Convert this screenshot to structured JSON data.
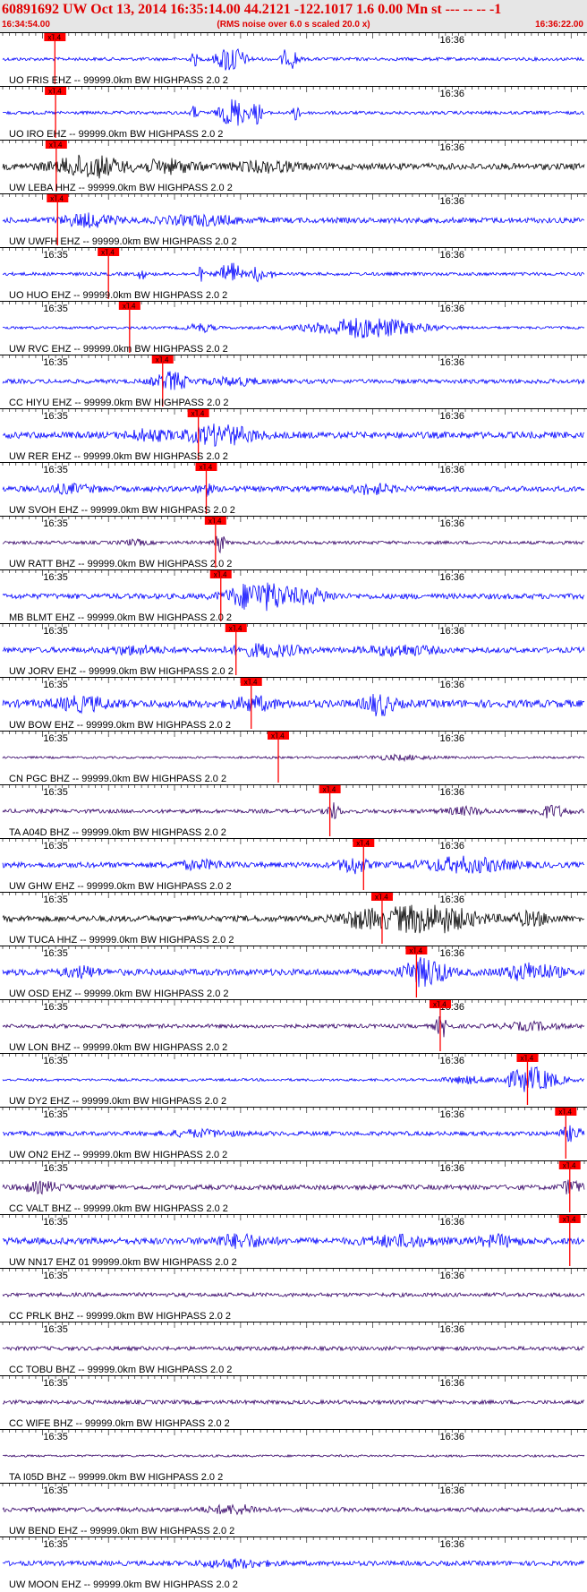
{
  "header": {
    "title": "60891692 UW Oct 13, 2014 16:35:14.00   44.2121 -122.1017  1.6 0.00 Mn st --- -- --  -1",
    "time_start": "16:34:54.00",
    "subtitle": "(RMS noise over 6.0 s scaled 20.0 x)",
    "time_end": "16:36:22.00"
  },
  "colors": {
    "header_bg": "#e6e6e6",
    "header_text": "#e00000",
    "pick": "#ff0000",
    "trace_blue": "#0000ff",
    "trace_black": "#000000",
    "trace_purple": "#330066"
  },
  "chart_data": {
    "type": "line",
    "description_free": true,
    "x_unit": "seconds after 16:34:54.00",
    "xlim": [
      0,
      88
    ],
    "tick_labels": {
      "16:35": 6,
      "16:36": 66
    },
    "pick_label": "xT.4",
    "series": [
      {
        "label": "UO FRIS EHZ -- 99999.0km BW  HIGHPASS  2.0  2",
        "pick_s": 7.9,
        "color": "#0000ff",
        "show_1635": false,
        "bursts": [
          [
            34.5,
            4,
            1.3
          ],
          [
            44,
            1.5,
            0.8
          ],
          [
            29,
            1,
            0.6
          ],
          [
            42.5,
            0.8,
            0.8
          ]
        ],
        "base": 0.15
      },
      {
        "label": "UO IRO EHZ -- 99999.0km BW  HIGHPASS  2.0  2",
        "pick_s": 8.0,
        "color": "#0000ff",
        "show_1635": false,
        "bursts": [
          [
            35,
            4,
            1.3
          ],
          [
            38.5,
            1.5,
            0.9
          ],
          [
            44.5,
            1,
            0.8
          ],
          [
            29,
            1,
            0.6
          ]
        ],
        "base": 0.15
      },
      {
        "label": "UW LEBA HHZ -- 99999.0km BW  HIGHPASS  2.0  2",
        "pick_s": 8.1,
        "color": "#000000",
        "show_1635": false,
        "bursts": [
          [
            13,
            10,
            0.9
          ],
          [
            25,
            8,
            0.5
          ],
          [
            40,
            10,
            0.35
          ]
        ],
        "base": 0.3
      },
      {
        "label": "UW UWFH EHZ -- 99999.0km BW  HIGHPASS  2.0  2",
        "pick_s": 8.3,
        "color": "#0000ff",
        "show_1635": false,
        "bursts": [
          [
            13,
            8,
            0.5
          ],
          [
            30,
            12,
            0.35
          ]
        ],
        "base": 0.25
      },
      {
        "label": "UO HUO EHZ -- 99999.0km BW  HIGHPASS  2.0  2",
        "pick_s": 16.0,
        "color": "#0000ff",
        "show_1635": true,
        "bursts": [
          [
            34.5,
            3,
            1.1
          ],
          [
            38.5,
            1.5,
            0.8
          ],
          [
            30,
            1,
            0.6
          ],
          [
            21,
            1,
            0.5
          ],
          [
            40.5,
            1,
            0.5
          ]
        ],
        "base": 0.15
      },
      {
        "label": "UW RVC EHZ -- 99999.0km BW  HIGHPASS  2.0  2",
        "pick_s": 19.2,
        "color": "#0000ff",
        "show_1635": true,
        "bursts": [
          [
            55,
            16,
            0.9
          ],
          [
            30,
            4,
            0.35
          ]
        ],
        "base": 0.12
      },
      {
        "label": "CC HIYU EHZ -- 99999.0km BW  HIGHPASS  2.0  2",
        "pick_s": 24.2,
        "color": "#0000ff",
        "show_1635": true,
        "bursts": [
          [
            25.5,
            5,
            0.8
          ],
          [
            35,
            8,
            0.3
          ]
        ],
        "base": 0.2
      },
      {
        "label": "UW RER EHZ -- 99999.0km BW  HIGHPASS  2.0  2",
        "pick_s": 29.6,
        "color": "#0000ff",
        "show_1635": true,
        "bursts": [
          [
            33,
            10,
            0.8
          ],
          [
            22,
            6,
            0.4
          ]
        ],
        "base": 0.3
      },
      {
        "label": "UW SVOH EHZ -- 99999.0km BW  HIGHPASS  2.0  2",
        "pick_s": 30.8,
        "color": "#0000ff",
        "show_1635": true,
        "bursts": [
          [
            30.5,
            2,
            0.6
          ],
          [
            56,
            6,
            0.4
          ],
          [
            10,
            8,
            0.3
          ]
        ],
        "base": 0.25
      },
      {
        "label": "UW RATT BHZ -- 99999.0km BW  HIGHPASS  2.0  2",
        "pick_s": 32.2,
        "color": "#330066",
        "show_1635": true,
        "bursts": [
          [
            32.8,
            1.5,
            0.9
          ],
          [
            20,
            4,
            0.2
          ]
        ],
        "base": 0.15
      },
      {
        "label": "MB BLMT EHZ -- 99999.0km BW  HIGHPASS  2.0  2",
        "pick_s": 33.0,
        "color": "#0000ff",
        "show_1635": true,
        "bursts": [
          [
            39,
            9,
            1.4
          ],
          [
            47,
            6,
            0.5
          ]
        ],
        "base": 0.25
      },
      {
        "label": "UW JORV EHZ -- 99999.0km BW  HIGHPASS  2.0  2",
        "pick_s": 35.3,
        "color": "#0000ff",
        "show_1635": true,
        "bursts": [
          [
            40,
            10,
            0.5
          ],
          [
            60,
            10,
            0.4
          ],
          [
            20,
            8,
            0.3
          ]
        ],
        "base": 0.25
      },
      {
        "label": "UW BOW EHZ -- 99999.0km BW  HIGHPASS  2.0  2",
        "pick_s": 37.6,
        "color": "#0000ff",
        "show_1635": true,
        "bursts": [
          [
            57,
            4,
            0.9
          ],
          [
            12,
            8,
            0.5
          ],
          [
            38,
            6,
            0.5
          ]
        ],
        "base": 0.35
      },
      {
        "label": "CN PGC BHZ -- 99999.0km BW  HIGHPASS  2.0  2",
        "pick_s": 41.7,
        "color": "#330066",
        "show_1635": true,
        "bursts": [
          [
            60,
            10,
            0.2
          ]
        ],
        "base": 0.1
      },
      {
        "label": "TA A04D BHZ -- 99999.0km BW  HIGHPASS  2.0  2",
        "pick_s": 49.5,
        "color": "#330066",
        "show_1635": true,
        "bursts": [
          [
            50,
            2,
            0.7
          ],
          [
            83,
            5,
            0.5
          ],
          [
            70,
            6,
            0.3
          ]
        ],
        "base": 0.18
      },
      {
        "label": "UW GHW EHZ -- 99999.0km BW  HIGHPASS  2.0  2",
        "pick_s": 54.6,
        "color": "#0000ff",
        "show_1635": true,
        "bursts": [
          [
            53,
            4,
            0.7
          ],
          [
            70,
            14,
            0.6
          ],
          [
            30,
            8,
            0.3
          ]
        ],
        "base": 0.25
      },
      {
        "label": "UW TUCA HHZ -- 99999.0km BW  HIGHPASS  2.0  2",
        "pick_s": 57.4,
        "color": "#000000",
        "show_1635": true,
        "bursts": [
          [
            64,
            14,
            1.3
          ],
          [
            54,
            6,
            0.6
          ],
          [
            80,
            6,
            0.5
          ]
        ],
        "base": 0.28
      },
      {
        "label": "UW OSD EHZ -- 99999.0km BW  HIGHPASS  2.0  2",
        "pick_s": 62.6,
        "color": "#0000ff",
        "show_1635": true,
        "bursts": [
          [
            64,
            6,
            1.3
          ],
          [
            80,
            8,
            0.7
          ],
          [
            12,
            5,
            0.4
          ]
        ],
        "base": 0.3
      },
      {
        "label": "UW LON BHZ -- 99999.0km BW  HIGHPASS  2.0  2",
        "pick_s": 66.2,
        "color": "#330066",
        "show_1635": true,
        "bursts": [
          [
            66.5,
            2,
            0.9
          ],
          [
            80,
            8,
            0.3
          ]
        ],
        "base": 0.18
      },
      {
        "label": "UW DY2 EHZ -- 99999.0km BW  HIGHPASS  2.0  2",
        "pick_s": 79.4,
        "color": "#0000ff",
        "show_1635": true,
        "bursts": [
          [
            80,
            8,
            1.1
          ],
          [
            70,
            6,
            0.3
          ]
        ],
        "base": 0.12
      },
      {
        "label": "UW ON2 EHZ -- 99999.0km BW  HIGHPASS  2.0  2",
        "pick_s": 85.2,
        "color": "#0000ff",
        "show_1635": true,
        "bursts": [
          [
            86,
            3,
            0.6
          ],
          [
            30,
            10,
            0.25
          ]
        ],
        "base": 0.2
      },
      {
        "label": "CC VALT BHZ -- 99999.0km BW  HIGHPASS  2.0  2",
        "pick_s": 85.8,
        "color": "#330066",
        "show_1635": true,
        "bursts": [
          [
            86,
            3,
            0.6
          ],
          [
            6,
            6,
            0.4
          ]
        ],
        "base": 0.22
      },
      {
        "label": "UW NN17 EHZ 01 99999.0km BW  HIGHPASS  2.0  2",
        "pick_s": 85.8,
        "color": "#0000ff",
        "show_1635": true,
        "bursts": [
          [
            36,
            8,
            0.5
          ],
          [
            60,
            10,
            0.4
          ],
          [
            75,
            6,
            0.4
          ]
        ],
        "base": 0.3
      },
      {
        "label": "CC PRLK BHZ -- 99999.0km BW  HIGHPASS  2.0  2",
        "pick_s": null,
        "color": "#330066",
        "show_1635": true,
        "bursts": [],
        "base": 0.18
      },
      {
        "label": "CC TOBU BHZ -- 99999.0km BW  HIGHPASS  2.0  2",
        "pick_s": null,
        "color": "#330066",
        "show_1635": true,
        "bursts": [],
        "base": 0.18
      },
      {
        "label": "CC WIFE BHZ -- 99999.0km BW  HIGHPASS  2.0  2",
        "pick_s": null,
        "color": "#330066",
        "show_1635": true,
        "bursts": [],
        "base": 0.18
      },
      {
        "label": "TA I05D BHZ -- 99999.0km BW  HIGHPASS  2.0  2",
        "pick_s": null,
        "color": "#330066",
        "show_1635": true,
        "bursts": [],
        "base": 0.1
      },
      {
        "label": "UW BEND EHZ -- 99999.0km BW  HIGHPASS  2.0  2",
        "pick_s": null,
        "color": "#330066",
        "show_1635": true,
        "bursts": [
          [
            35,
            8,
            0.35
          ]
        ],
        "base": 0.2
      },
      {
        "label": "UW MOON EHZ -- 99999.0km BW  HIGHPASS  2.0  2",
        "pick_s": null,
        "color": "#0000ff",
        "show_1635": true,
        "bursts": [
          [
            35,
            10,
            0.3
          ]
        ],
        "base": 0.22
      }
    ]
  }
}
